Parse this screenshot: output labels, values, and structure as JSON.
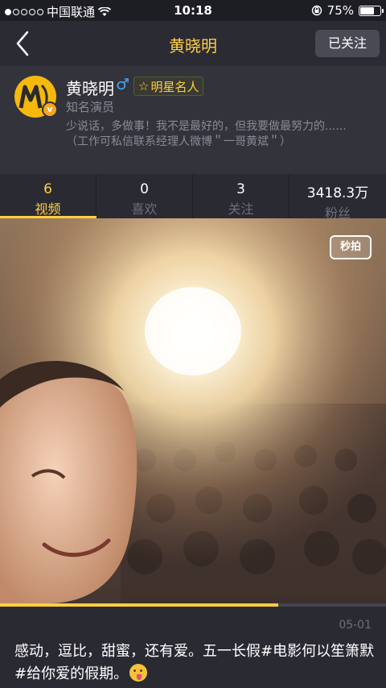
{
  "status_bar": {
    "carrier": "中国联通",
    "time": "10:18",
    "battery_percent": "75%",
    "battery_level": 0.75,
    "signal_bars": 1
  },
  "nav": {
    "title": "黄晓明",
    "follow_label": "已关注"
  },
  "profile": {
    "name": "黄晓明",
    "gender_symbol": "♂",
    "badge_icon": "☆",
    "badge_label": "明星名人",
    "occupation": "知名演员",
    "bio": "少说话，多做事！我不是最好的，但我要做最努力的......（工作可私信联系经理人微博＂一哥黄斌＂）",
    "verified_mark": "v"
  },
  "stats": [
    {
      "num": "6",
      "label": "视频"
    },
    {
      "num": "0",
      "label": "喜欢"
    },
    {
      "num": "3",
      "label": "关注"
    },
    {
      "num": "3418.3万",
      "label": "粉丝"
    }
  ],
  "video": {
    "watermark": "秒拍",
    "progress": 0.72
  },
  "post": {
    "date": "05-01",
    "text": "感动，逗比，甜蜜，还有爱。五一长假#电影何以笙箫默#给你爱的假期。",
    "emoji": "tongue-out-emoji"
  },
  "colors": {
    "accent": "#ffcf40",
    "background": "#2a2a33"
  }
}
